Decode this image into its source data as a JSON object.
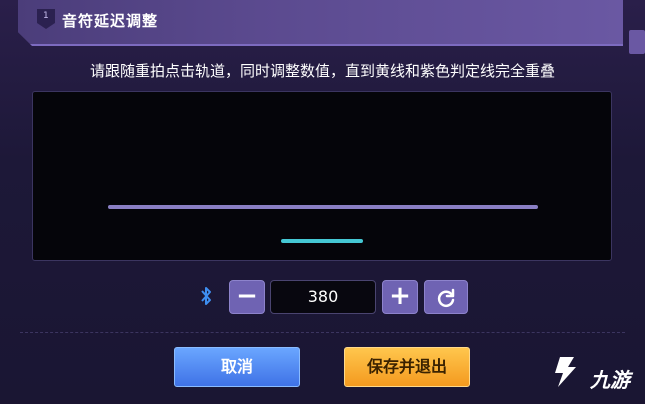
{
  "dialog": {
    "title": "音符延迟调整",
    "instruction": "请跟随重拍点击轨道，同时调整数值，直到黄线和紫色判定线完全重叠"
  },
  "controls": {
    "value": "380",
    "minus_symbol": "−",
    "plus_symbol": "+",
    "bluetooth_icon": "bluetooth-icon",
    "reset_icon": "reset-icon"
  },
  "buttons": {
    "cancel_label": "取消",
    "save_label": "保存并退出"
  },
  "watermark": {
    "text": "九游"
  },
  "colors": {
    "judgement_line": "#8a7fc4",
    "note_line": "#45c8d4",
    "cancel_button": "#4a82f0",
    "save_button": "#f5a623"
  }
}
